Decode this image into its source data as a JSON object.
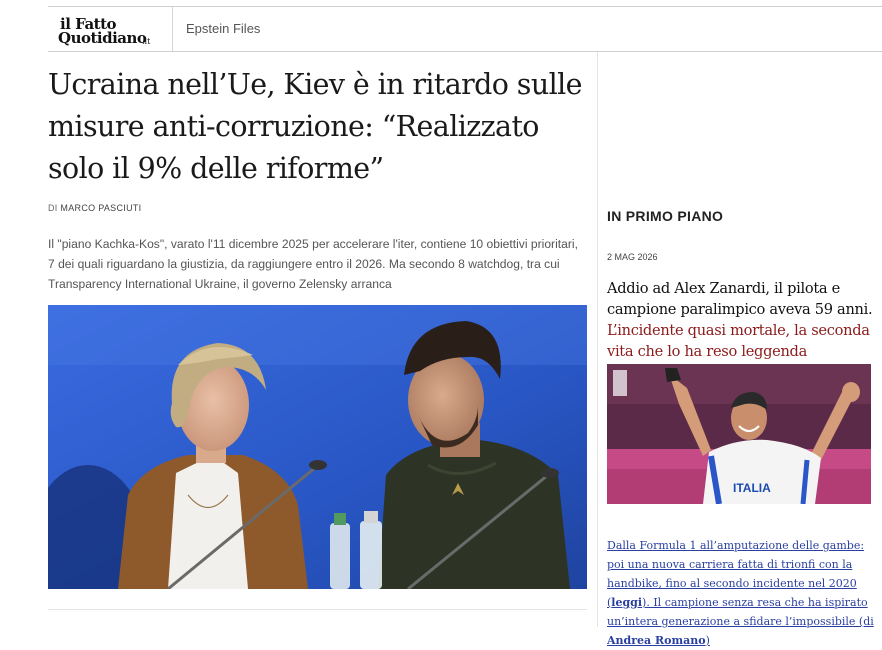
{
  "header": {
    "logo": {
      "line1": "il Fatto",
      "line2": "Quotidiano",
      "suffix": ".it",
      "tagline": ""
    },
    "nav_link": "Epstein Files"
  },
  "article": {
    "title": "Ucraina nell’Ue, Kiev è in ritardo sulle misure anti-corruzione: “Realizzato solo il 9% delle riforme”",
    "byline_prefix": "DI",
    "author": "MARCO PASCIUTI",
    "summary": "Il \"piano Kachka-Kos\", varato l'11 dicembre 2025 per accelerare l'iter, contiene 10 obiettivi prioritari, 7 dei quali riguardano la giustizia, da raggiungere entro il 2026. Ma secondo 8 watchdog, tra cui Transparency International Ukraine, il governo Zelensky arranca"
  },
  "sidebar": {
    "section_title": "IN PRIMO PIANO",
    "date": "2 MAG 2026",
    "headline_black": "Addio ad Alex Zanardi, il pilota e campione paralimpico aveva 59 anni.",
    "headline_red": "L’incidente quasi mortale, la seconda vita che lo ha reso leggenda",
    "blurb_part1": "Dalla Formula 1 all’amputazione delle gambe: poi una nuova carriera fatta di trionfi con la handbike, fino al secondo incidente nel 2020 (",
    "blurb_link1": "leggi",
    "blurb_part2": "). Il campione senza resa che ha ispirato un’intera generazione a sfidare l’impossibile (di ",
    "blurb_author": "Andrea Romano",
    "blurb_part3": ")"
  },
  "colors": {
    "accent_red": "#8c1a1a",
    "link_blue": "#2a3fa0",
    "hero_background": "#2f5fd0"
  }
}
